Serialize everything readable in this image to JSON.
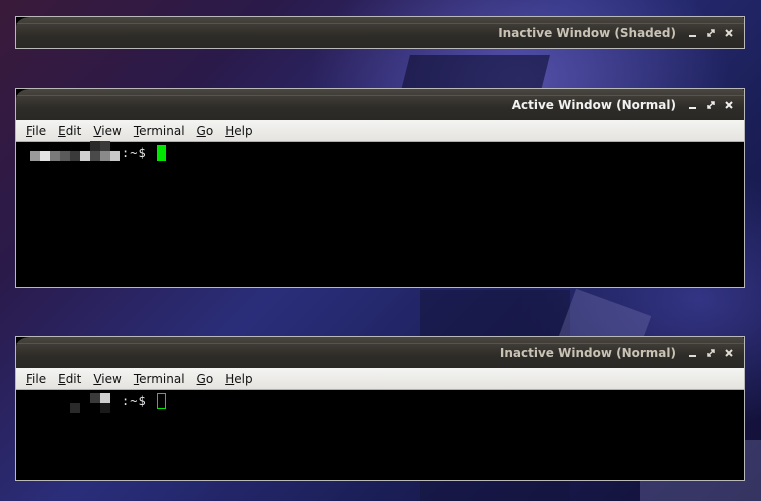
{
  "windows": [
    {
      "title": "Inactive Window (Shaded)",
      "state": "shaded"
    },
    {
      "title": "Active Window (Normal)",
      "state": "active",
      "menu": [
        {
          "mnemonic": "F",
          "rest": "ile"
        },
        {
          "mnemonic": "E",
          "rest": "dit"
        },
        {
          "mnemonic": "V",
          "rest": "iew"
        },
        {
          "mnemonic": "",
          "pre": "",
          "rest": "Terminal",
          "underline_index": 0
        },
        {
          "mnemonic": "G",
          "rest": "o"
        },
        {
          "mnemonic": "H",
          "rest": "elp"
        }
      ],
      "prompt_suffix": ":~$",
      "cursor": "solid"
    },
    {
      "title": "Inactive Window (Normal)",
      "state": "inactive",
      "menu": [
        {
          "mnemonic": "F",
          "rest": "ile"
        },
        {
          "mnemonic": "E",
          "rest": "dit"
        },
        {
          "mnemonic": "V",
          "rest": "iew"
        },
        {
          "mnemonic": "T",
          "rest": "erminal"
        },
        {
          "mnemonic": "G",
          "rest": "o"
        },
        {
          "mnemonic": "H",
          "rest": "elp"
        }
      ],
      "prompt_suffix": ":~$",
      "cursor": "hollow"
    }
  ],
  "colors": {
    "cursor": "#00e600",
    "menubar": "#ecebe8",
    "titlebar": "#35332e",
    "terminal_bg": "#000000"
  },
  "icons": {
    "minimize": "minimize-icon",
    "maximize": "maximize-icon",
    "close": "close-icon"
  }
}
